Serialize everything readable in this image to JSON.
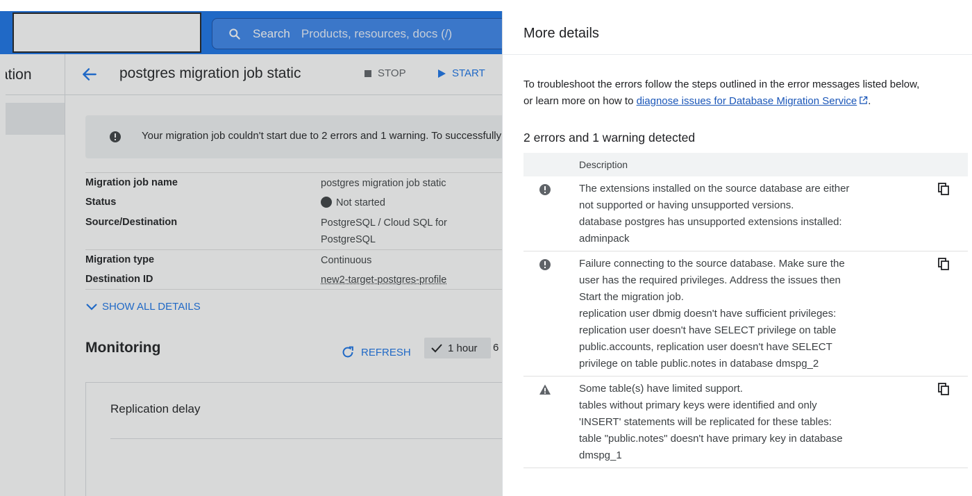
{
  "header": {
    "search_label": "Search",
    "search_placeholder": "Products, resources, docs (/)"
  },
  "nav": {
    "title_fragment": "ation"
  },
  "job": {
    "title": "postgres migration job static",
    "stop_label": "STOP",
    "start_label": "START"
  },
  "banner": {
    "text": "Your migration job couldn't start due to 2 errors and 1 warning. To successfully start"
  },
  "details": {
    "rows": [
      {
        "key": "Migration job name",
        "value": "postgres migration job static"
      },
      {
        "key": "Status",
        "value": "Not started"
      },
      {
        "key": "Source/Destination",
        "value_line1": "PostgreSQL / Cloud SQL for",
        "value_line2": "PostgreSQL"
      },
      {
        "key": "Migration type",
        "value": "Continuous"
      },
      {
        "key": "Destination ID",
        "value": "new2-target-postgres-profile"
      }
    ],
    "show_all_label": "SHOW ALL DETAILS"
  },
  "monitoring": {
    "title": "Monitoring",
    "refresh_label": "REFRESH",
    "range_selected": "1 hour",
    "range_next": "6",
    "card_title": "Replication delay"
  },
  "panel": {
    "title": "More details",
    "intro_line1": "To troubleshoot the errors follow the steps outlined in the error messages listed below,",
    "intro_prefix": "or learn more on how to ",
    "intro_link": "diagnose issues for Database Migration Service",
    "intro_suffix": ".",
    "summary": "2 errors and 1 warning detected",
    "column_header": "Description",
    "issues": [
      {
        "severity": "error",
        "lines": [
          "The extensions installed on the source database are either",
          "not supported or having unsupported versions.",
          "database postgres has unsupported extensions installed:",
          "adminpack"
        ]
      },
      {
        "severity": "error",
        "lines": [
          "Failure connecting to the source database. Make sure the",
          "user has the required privileges. Address the issues then",
          "Start the migration job.",
          "replication user dbmig doesn't have sufficient privileges:",
          "replication user doesn't have SELECT privilege on table",
          "public.accounts, replication user doesn't have SELECT",
          "privilege on table public.notes in database dmspg_2"
        ]
      },
      {
        "severity": "warning",
        "lines": [
          "Some table(s) have limited support.",
          "tables without primary keys were identified and only",
          "'INSERT' statements will be replicated for these tables:",
          "table \"public.notes\" doesn't have primary key in database",
          "dmspg_1"
        ]
      }
    ]
  },
  "colors": {
    "brand_blue": "#1a73e8",
    "text": "#202124",
    "muted": "#5f6368",
    "icon_error": "#5f6368"
  }
}
